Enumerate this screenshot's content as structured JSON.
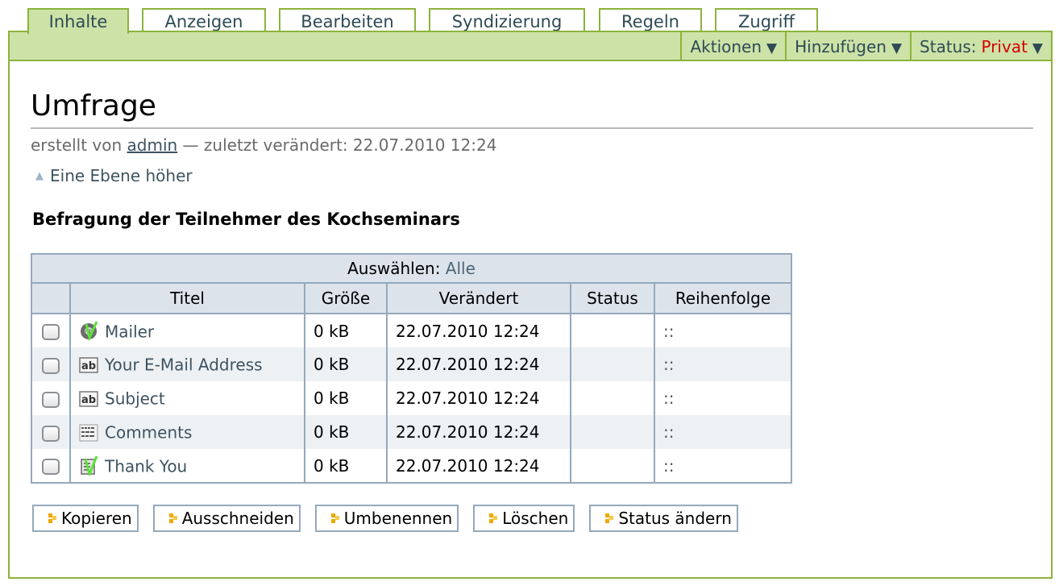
{
  "tabs": [
    {
      "label": "Inhalte",
      "active": true
    },
    {
      "label": "Anzeigen"
    },
    {
      "label": "Bearbeiten"
    },
    {
      "label": "Syndizierung"
    },
    {
      "label": "Regeln"
    },
    {
      "label": "Zugriff"
    }
  ],
  "actions": {
    "aktionen": "Aktionen",
    "hinzufuegen": "Hinzufügen",
    "status_label": "Status:",
    "status_value": "Privat",
    "arrow": "▼"
  },
  "page": {
    "title": "Umfrage",
    "byline_prefix": "erstellt von",
    "author": "admin",
    "byline_suffix": "— zuletzt verändert: 22.07.2010 12:24",
    "up_label": "Eine Ebene höher",
    "description": "Befragung der Teilnehmer des Kochseminars"
  },
  "table": {
    "select_label": "Auswählen:",
    "select_all": "Alle",
    "columns": [
      "Titel",
      "Größe",
      "Verändert",
      "Status",
      "Reihenfolge"
    ],
    "rows": [
      {
        "title": "Mailer",
        "icon": "mailer-icon",
        "size": "0 kB",
        "modified": "22.07.2010 12:24",
        "status": "",
        "order": "::"
      },
      {
        "title": "Your E-Mail Address",
        "icon": "text-field-icon",
        "size": "0 kB",
        "modified": "22.07.2010 12:24",
        "status": "",
        "order": "::"
      },
      {
        "title": "Subject",
        "icon": "text-field-icon",
        "size": "0 kB",
        "modified": "22.07.2010 12:24",
        "status": "",
        "order": "::"
      },
      {
        "title": "Comments",
        "icon": "textarea-icon",
        "size": "0 kB",
        "modified": "22.07.2010 12:24",
        "status": "",
        "order": "::"
      },
      {
        "title": "Thank You",
        "icon": "thanks-page-icon",
        "size": "0 kB",
        "modified": "22.07.2010 12:24",
        "status": "",
        "order": "::"
      }
    ]
  },
  "buttons": {
    "copy": "Kopieren",
    "cut": "Ausschneiden",
    "rename": "Umbenennen",
    "delete": "Löschen",
    "change_state": "Status ändern"
  },
  "colors": {
    "tab_border": "#8cb33c",
    "bar_bg": "#cde2a7",
    "status_private": "#d40000",
    "table_header": "#dce3eb",
    "table_border": "#94a9bc"
  }
}
